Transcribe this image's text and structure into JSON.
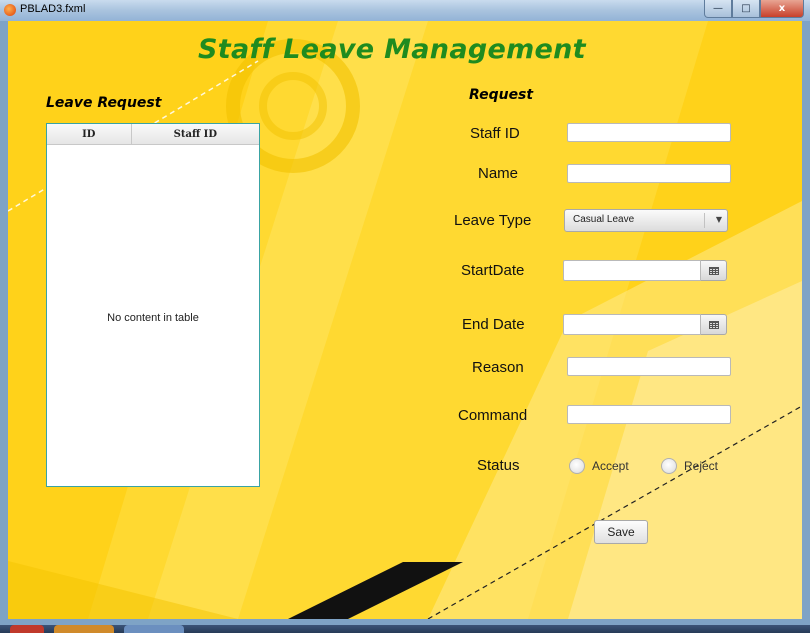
{
  "window": {
    "title": "PBLAD3.fxml",
    "controls": {
      "minimize": "—",
      "maximize": "□",
      "close": "x"
    }
  },
  "app": {
    "title": "Staff Leave Management"
  },
  "left_panel": {
    "heading": "Leave Request",
    "table": {
      "columns": [
        "ID",
        "Staff ID"
      ],
      "rows": [],
      "placeholder": "No content in table"
    }
  },
  "form": {
    "heading": "Request",
    "staff_id": {
      "label": "Staff ID",
      "value": ""
    },
    "name": {
      "label": "Name",
      "value": ""
    },
    "leave_type": {
      "label": "Leave Type",
      "selected": "Casual Leave"
    },
    "start_date": {
      "label": "StartDate",
      "value": ""
    },
    "end_date": {
      "label": "End Date",
      "value": ""
    },
    "reason": {
      "label": "Reason",
      "value": ""
    },
    "command": {
      "label": "Command",
      "value": ""
    },
    "status": {
      "label": "Status",
      "options": [
        "Accept",
        "Reject"
      ],
      "selected": null
    },
    "save_label": "Save"
  },
  "icons": {
    "title_icon": "app-icon",
    "combo_arrow": "chevron-down-icon",
    "date_picker": "calendar-icon"
  },
  "colors": {
    "background": "#ffd21a",
    "title": "#1f8b1f",
    "table_border": "#3aa3a3"
  }
}
